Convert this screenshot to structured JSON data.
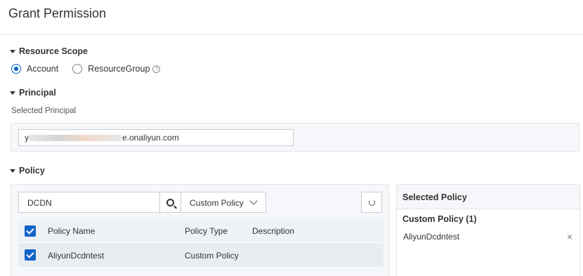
{
  "header": {
    "title": "Grant Permission"
  },
  "resource_scope": {
    "title": "Resource Scope",
    "options": [
      {
        "label": "Account",
        "checked": true
      },
      {
        "label": "ResourceGroup",
        "checked": false
      }
    ],
    "help_glyph": "?"
  },
  "principal": {
    "title": "Principal",
    "selected_label": "Selected Principal",
    "value_suffix": "e.onaliyun.com",
    "value_prefix_visible": "y"
  },
  "policy": {
    "title": "Policy",
    "search": {
      "value": "DCDN",
      "icon": "search-icon"
    },
    "type_filter": {
      "selected": "Custom Policy",
      "icon": "chevron-down-icon"
    },
    "refresh_icon": "refresh-icon",
    "table": {
      "columns": [
        "Policy Name",
        "Policy Type",
        "Description"
      ],
      "rows": [
        {
          "checked": true,
          "name": "AliyunDcdntest",
          "type": "Custom Policy",
          "description": ""
        }
      ],
      "header_checked": true
    }
  },
  "selected_policy": {
    "title": "Selected Policy",
    "group_label": "Custom Policy (1)",
    "items": [
      "AliyunDcdntest"
    ],
    "remove_glyph": "×"
  },
  "colors": {
    "accent": "#0064c8",
    "checkbox": "#1264c9",
    "panel_bg": "#f5f7fa"
  }
}
